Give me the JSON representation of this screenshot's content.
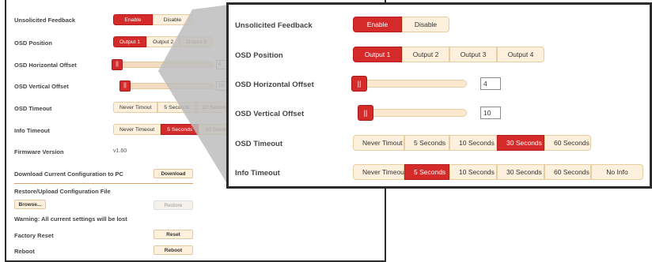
{
  "labels": {
    "unsolicited_feedback": "Unsolicited Feedback",
    "osd_position": "OSD Position",
    "osd_h_offset": "OSD Horizontal Offset",
    "osd_v_offset": "OSD Vertical Offset",
    "osd_timeout": "OSD Timeout",
    "info_timeout": "Info Timeout",
    "firmware_version": "Firmware Version",
    "download_config": "Download Current Configuration to PC",
    "restore_config": "Restore/Upload Configuration File",
    "warning": "Warning: All current settings will be lost",
    "factory_reset": "Factory Reset",
    "reboot": "Reboot"
  },
  "feedback": {
    "enable": "Enable",
    "disable": "Disable",
    "selected": "Enable"
  },
  "osd_position": {
    "options": [
      "Output 1",
      "Output 2",
      "Output 3",
      "Output 4"
    ],
    "selected": "Output 1"
  },
  "osd_h_offset": {
    "value": "4",
    "thumb_glyph": "||"
  },
  "osd_v_offset": {
    "value": "10",
    "thumb_glyph": "||"
  },
  "osd_timeout": {
    "options": [
      "Never Timout",
      "5 Seconds",
      "10 Seconds",
      "30 Seconds",
      "60 Seconds"
    ],
    "selected": "30 Seconds"
  },
  "info_timeout": {
    "options": [
      "Never Timeout",
      "5 Seconds",
      "10 Seconds",
      "30 Seconds",
      "60 Seconds",
      "No Info"
    ],
    "selected": "5 Seconds"
  },
  "firmware": {
    "version": "v1.60"
  },
  "buttons": {
    "download": "Download",
    "browse": "Browse...",
    "restore": "Restore",
    "reset": "Reset",
    "reboot": "Reboot"
  },
  "colors": {
    "accent": "#d42a2a",
    "button_bg": "#fdf0dc",
    "border": "#2b2b2b"
  }
}
